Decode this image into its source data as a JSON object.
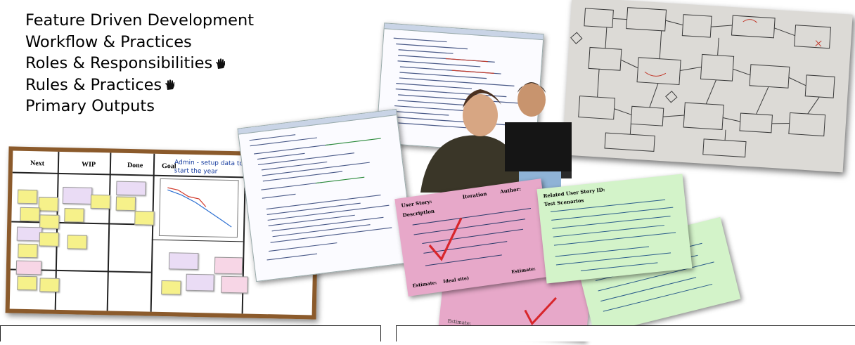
{
  "headings": [
    {
      "text": "Feature Driven Development",
      "hand": false
    },
    {
      "text": "Workflow & Practices",
      "hand": false
    },
    {
      "text": "Roles & Responsibilities",
      "hand": true
    },
    {
      "text": "Rules & Practices",
      "hand": true
    },
    {
      "text": "Primary Outputs",
      "hand": false
    }
  ],
  "kanban": {
    "columns": [
      "Next",
      "WIP",
      "Done",
      "Goal"
    ],
    "goal_note": "Admin - setup data to start the year"
  },
  "cards": {
    "pink_top": {
      "labels": [
        "User Story:",
        "Iteration",
        "Author:"
      ],
      "section": "Description",
      "footer": [
        "Estimate:",
        "Ideal site)",
        "Estimate:"
      ]
    },
    "green_top": {
      "labels": [
        "Related User Story ID:"
      ],
      "section": "Test Scenarios"
    }
  },
  "colors": {
    "board_frame": "#8b5a2b",
    "pink_card": "#e7a8c9",
    "green_card": "#d3f3c9",
    "check": "#d8262b"
  },
  "icons": [
    "hand-icon"
  ]
}
